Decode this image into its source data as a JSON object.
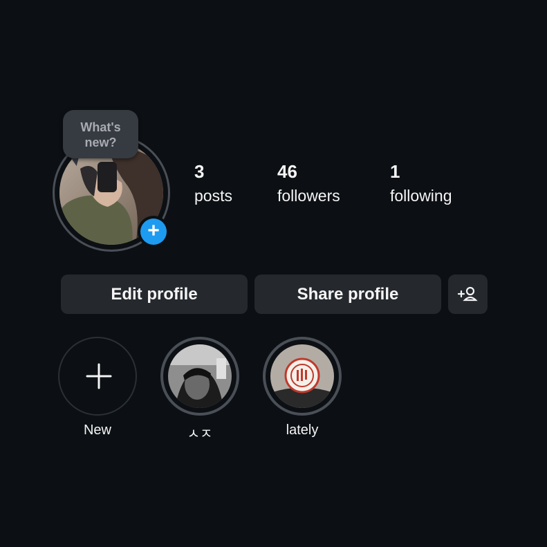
{
  "profile": {
    "whats_new": "What's\nnew?",
    "add_story_symbol": "+"
  },
  "stats": {
    "posts_count": "3",
    "posts_label": "posts",
    "followers_count": "46",
    "followers_label": "followers",
    "following_count": "1",
    "following_label": "following"
  },
  "actions": {
    "edit_profile": "Edit profile",
    "share_profile": "Share profile",
    "add_friend_symbol": "+👤"
  },
  "highlights": [
    {
      "label": "New",
      "symbol": "+"
    },
    {
      "label": "ㅅㅈ"
    },
    {
      "label": "lately"
    }
  ]
}
